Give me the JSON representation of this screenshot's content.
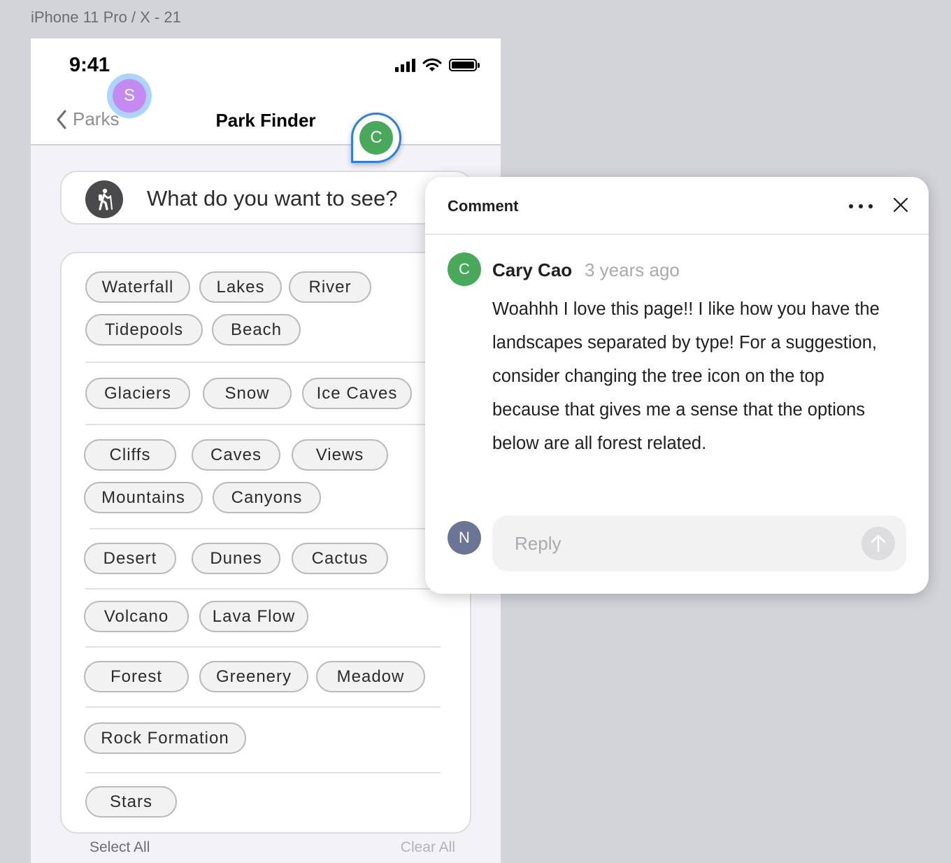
{
  "frame_label": "iPhone 11 Pro / X - 21",
  "status_bar": {
    "time": "9:41"
  },
  "nav": {
    "back_label": "Parks",
    "title": "Park Finder"
  },
  "search": {
    "prompt": "What do you want to see?"
  },
  "tag_groups": [
    [
      "Waterfall",
      "Lakes",
      "River",
      "Tidepools",
      "Beach"
    ],
    [
      "Glaciers",
      "Snow",
      "Ice Caves"
    ],
    [
      "Cliffs",
      "Caves",
      "Views",
      "Mountains",
      "Canyons"
    ],
    [
      "Desert",
      "Dunes",
      "Cactus"
    ],
    [
      "Volcano",
      "Lava Flow"
    ],
    [
      "Forest",
      "Greenery",
      "Meadow"
    ],
    [
      "Rock Formation"
    ],
    [
      "Stars"
    ]
  ],
  "actions": {
    "select_all": "Select All",
    "clear_all": "Clear All"
  },
  "collaborators": {
    "viewer_initial": "S",
    "pin_initial": "C"
  },
  "comment": {
    "header": "Comment",
    "author_initial": "C",
    "author": "Cary Cao",
    "time": "3 years ago",
    "body": "Woahhh I love this page!! I like how you have the landscapes separated by type! For a suggestion, consider changing the tree icon on the top because that gives me a sense that the options below are all forest related.",
    "reply_initial": "N",
    "reply_placeholder": "Reply"
  }
}
